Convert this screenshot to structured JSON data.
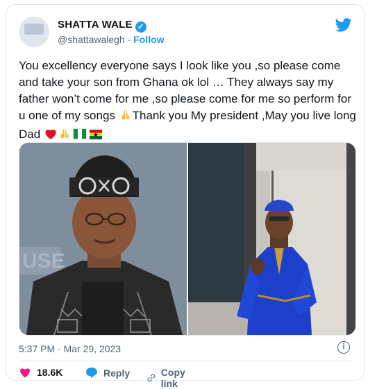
{
  "profile": {
    "name": "SHATTA WALE",
    "handle": "@shattawalegh",
    "separator": "·",
    "follow_label": "Follow"
  },
  "tweet": {
    "text": "You excellency everyone says I look like you ,so please come and take your son from Ghana ok lol … They always say my father won’t come for me ,so please come for me so perform for u one of my songs ",
    "text2": "Thank you My president ,May you live long  Dad",
    "emojis": [
      "folded-hands",
      "red-heart",
      "folded-hands",
      "flag-nigeria",
      "flag-ghana"
    ]
  },
  "meta": {
    "timestamp": "5:37 PM · Mar 29, 2023"
  },
  "actions": {
    "likes": "18.6K",
    "reply_label": "Reply",
    "copy_label": "Copy link"
  },
  "colors": {
    "accent": "#1d9bf0",
    "like": "#f91880",
    "muted": "#536471"
  }
}
